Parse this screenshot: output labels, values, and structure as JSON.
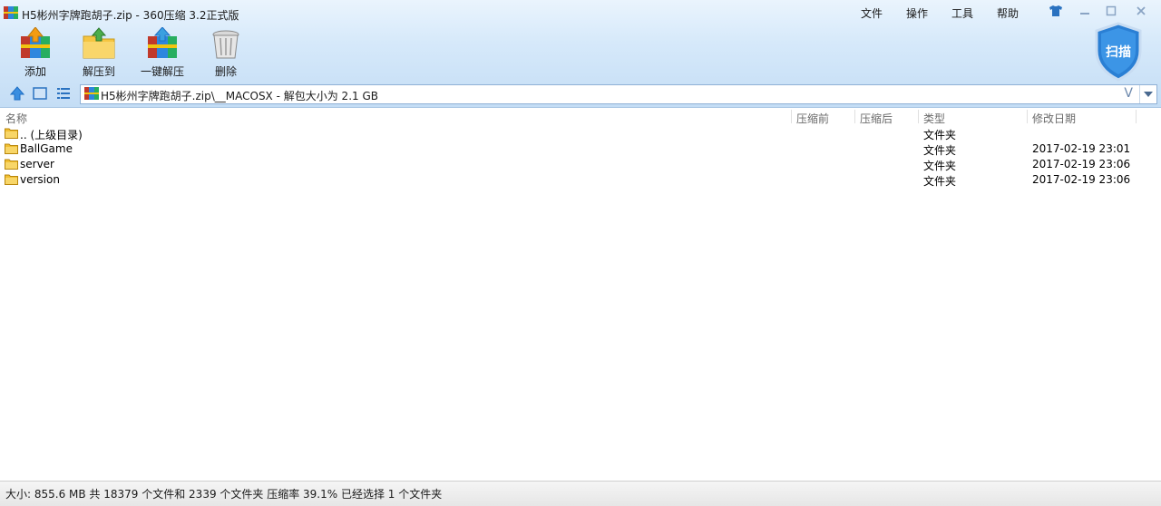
{
  "window": {
    "title": "H5彬州字牌跑胡子.zip - 360压缩 3.2正式版",
    "menu": [
      "文件",
      "操作",
      "工具",
      "帮助"
    ]
  },
  "toolbar": {
    "buttons": [
      {
        "label": "添加",
        "icon": "add-archive-icon"
      },
      {
        "label": "解压到",
        "icon": "extract-to-icon"
      },
      {
        "label": "一键解压",
        "icon": "one-click-extract-icon"
      },
      {
        "label": "删除",
        "icon": "trash-icon"
      }
    ],
    "scan_label": "扫描"
  },
  "address": {
    "path": "H5彬州字牌跑胡子.zip\\__MACOSX - 解包大小为 2.1 GB",
    "search_glyph": "V"
  },
  "columns": [
    "名称",
    "压缩前",
    "压缩后",
    "类型",
    "修改日期"
  ],
  "files": [
    {
      "name": ".. (上级目录)",
      "type": "文件夹",
      "date": ""
    },
    {
      "name": "BallGame",
      "type": "文件夹",
      "date": "2017-02-19 23:01"
    },
    {
      "name": "server",
      "type": "文件夹",
      "date": "2017-02-19 23:06"
    },
    {
      "name": "version",
      "type": "文件夹",
      "date": "2017-02-19 23:06"
    }
  ],
  "status": "大小: 855.6 MB 共 18379 个文件和 2339 个文件夹 压缩率 39.1% 已经选择 1 个文件夹",
  "colors": {
    "accent": "#1f6fc4",
    "folder": "#f2c033"
  }
}
